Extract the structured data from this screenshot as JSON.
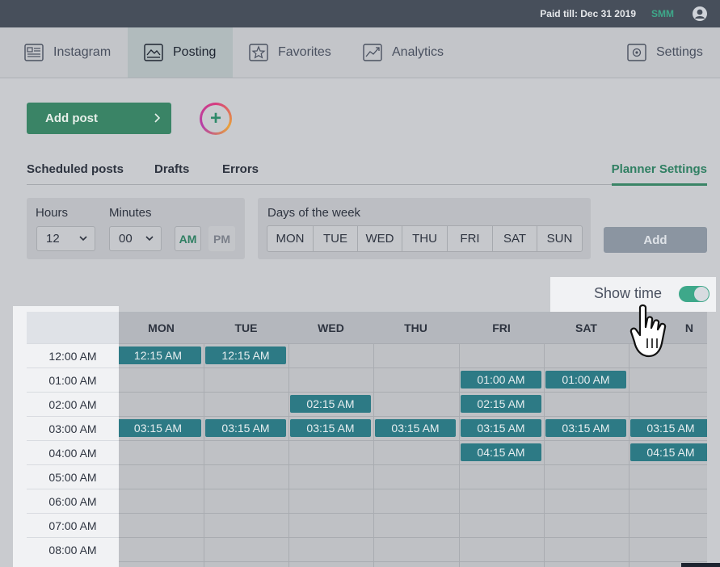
{
  "topbar": {
    "paid_text": "Paid till: Dec 31 2019",
    "plan": "SMM",
    "user_icon": "user-circle-icon"
  },
  "nav": {
    "items": [
      {
        "label": "Instagram",
        "icon": "instagram-list-icon",
        "active": false
      },
      {
        "label": "Posting",
        "icon": "posting-image-icon",
        "active": true
      },
      {
        "label": "Favorites",
        "icon": "star-icon",
        "active": false
      },
      {
        "label": "Analytics",
        "icon": "chart-line-icon",
        "active": false
      },
      {
        "label": "Settings",
        "icon": "gear-icon",
        "active": false
      }
    ]
  },
  "actions": {
    "add_post_label": "Add post",
    "new_story_icon": "plus-circle-icon"
  },
  "subtabs": {
    "scheduled": "Scheduled posts",
    "drafts": "Drafts",
    "errors": "Errors",
    "planner": "Planner Settings"
  },
  "time_panel": {
    "hours_label": "Hours",
    "hours_value": "12",
    "minutes_label": "Minutes",
    "minutes_value": "00",
    "am": "AM",
    "pm": "PM",
    "selected_period": "AM"
  },
  "days_panel": {
    "label": "Days of the week",
    "days": [
      "MON",
      "TUE",
      "WED",
      "THU",
      "FRI",
      "SAT",
      "SUN"
    ]
  },
  "add_label": "Add",
  "show_time": {
    "label": "Show time",
    "enabled": true
  },
  "calendar": {
    "columns": [
      "MON",
      "TUE",
      "WED",
      "THU",
      "FRI",
      "SAT",
      "SUN"
    ],
    "column_header_partial": "N",
    "rows": [
      "12:00 AM",
      "01:00 AM",
      "02:00 AM",
      "03:00 AM",
      "04:00 AM",
      "05:00 AM",
      "06:00 AM",
      "07:00 AM",
      "08:00 AM"
    ],
    "slots": [
      {
        "day": 0,
        "row": 0,
        "label": "12:15 AM"
      },
      {
        "day": 1,
        "row": 0,
        "label": "12:15 AM"
      },
      {
        "day": 4,
        "row": 1,
        "label": "01:00 AM"
      },
      {
        "day": 5,
        "row": 1,
        "label": "01:00 AM"
      },
      {
        "day": 2,
        "row": 2,
        "label": "02:15 AM"
      },
      {
        "day": 4,
        "row": 2,
        "label": "02:15 AM"
      },
      {
        "day": 0,
        "row": 3,
        "label": "03:15 AM"
      },
      {
        "day": 1,
        "row": 3,
        "label": "03:15 AM"
      },
      {
        "day": 2,
        "row": 3,
        "label": "03:15 AM"
      },
      {
        "day": 3,
        "row": 3,
        "label": "03:15 AM"
      },
      {
        "day": 4,
        "row": 3,
        "label": "03:15 AM"
      },
      {
        "day": 5,
        "row": 3,
        "label": "03:15 AM"
      },
      {
        "day": 6,
        "row": 3,
        "label": "03:15 AM"
      },
      {
        "day": 4,
        "row": 4,
        "label": "04:15 AM"
      },
      {
        "day": 6,
        "row": 4,
        "label": "04:15 AM"
      }
    ]
  },
  "colors": {
    "accent": "#3a8466",
    "slot": "#2d7a85",
    "topbar": "#474f5b"
  }
}
